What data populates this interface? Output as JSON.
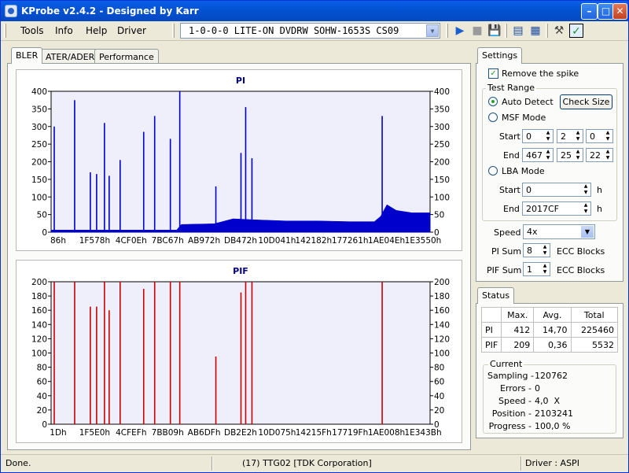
{
  "window": {
    "title": "KProbe v2.4.2 - Designed by Karr"
  },
  "menu": [
    "Tools",
    "Info",
    "Help",
    "Driver"
  ],
  "device": "1-0-0-0 LITE-ON DVDRW SOHW-1653S CS09",
  "tabs": [
    "BLER",
    "ATER/ADER",
    "Performance"
  ],
  "settings": {
    "tab": "Settings",
    "remove_spike": "Remove the spike",
    "test_range": "Test Range",
    "auto_detect": "Auto Detect",
    "check_size": "Check Size",
    "msf_mode": "MSF Mode",
    "start_label": "Start",
    "end_label": "End",
    "msf_start": [
      "0",
      "2",
      "0"
    ],
    "msf_end": [
      "467",
      "25",
      "22"
    ],
    "lba_mode": "LBA Mode",
    "lba_start": "0",
    "lba_end": "2017CF",
    "h": "h",
    "speed_label": "Speed",
    "speed_value": "4x",
    "pi_sum_label": "PI Sum",
    "pi_sum_value": "8",
    "pif_sum_label": "PIF Sum",
    "pif_sum_value": "1",
    "ecc_blocks": "ECC Blocks"
  },
  "status": {
    "tab": "Status",
    "headers": [
      "Max.",
      "Avg.",
      "Total"
    ],
    "rows": [
      {
        "label": "PI",
        "max": "412",
        "avg": "14,70",
        "total": "225460"
      },
      {
        "label": "PIF",
        "max": "209",
        "avg": "0,36",
        "total": "5532"
      }
    ],
    "current": "Current",
    "fields": [
      {
        "label": "Sampling -",
        "value": "120762"
      },
      {
        "label": "Errors -",
        "value": "0"
      },
      {
        "label": "Speed -",
        "value": "4,0  X"
      },
      {
        "label": "Position -",
        "value": "2103241"
      },
      {
        "label": "Progress -",
        "value": "100,0 %"
      }
    ]
  },
  "statusbar": {
    "left": "Done.",
    "middle": "(17) TTG02 [TDK Corporation]",
    "right": "Driver : ASPI"
  },
  "colors": {
    "pi_bar": "#0000cc",
    "pif_bar": "#cc0000",
    "plot_bg": "#efeffb",
    "title": "#000080"
  },
  "chart_data": [
    {
      "type": "bar",
      "title": "PI",
      "ylim": [
        0,
        400
      ],
      "yticks": [
        0,
        50,
        100,
        150,
        200,
        250,
        300,
        350,
        400
      ],
      "xticks": [
        "86h",
        "1F578h",
        "4CF0Eh",
        "7BC67h",
        "AB972h",
        "DB472h",
        "10D041h",
        "142182h",
        "177261h",
        "1AE04Eh",
        "1E3550h"
      ],
      "xrange": [
        0,
        120762
      ],
      "spikes": [
        [
          1000,
          300
        ],
        [
          7500,
          375
        ],
        [
          12500,
          170
        ],
        [
          14500,
          165
        ],
        [
          17000,
          310
        ],
        [
          18500,
          160
        ],
        [
          22000,
          205
        ],
        [
          29500,
          285
        ],
        [
          33000,
          330
        ],
        [
          38000,
          265
        ],
        [
          41000,
          410
        ],
        [
          52500,
          130
        ],
        [
          60500,
          225
        ],
        [
          62000,
          355
        ],
        [
          64000,
          210
        ],
        [
          105500,
          330
        ]
      ],
      "baseline": [
        [
          0,
          6
        ],
        [
          40000,
          6
        ],
        [
          41500,
          22
        ],
        [
          52000,
          24
        ],
        [
          58000,
          38
        ],
        [
          65000,
          35
        ],
        [
          75000,
          32
        ],
        [
          85000,
          32
        ],
        [
          95000,
          30
        ],
        [
          103000,
          30
        ],
        [
          105000,
          45
        ],
        [
          107000,
          78
        ],
        [
          110000,
          62
        ],
        [
          115000,
          55
        ],
        [
          120762,
          55
        ]
      ]
    },
    {
      "type": "bar",
      "title": "PIF",
      "ylim": [
        0,
        200
      ],
      "yticks": [
        0,
        20,
        40,
        60,
        80,
        100,
        120,
        140,
        160,
        180,
        200
      ],
      "xticks": [
        "1Dh",
        "1F5E0h",
        "4CFEFh",
        "7BB09h",
        "AB6DFh",
        "DB2E2h",
        "10D075h",
        "14215Fh",
        "17719Fh",
        "1AE008h",
        "1E343Bh"
      ],
      "xrange": [
        0,
        120762
      ],
      "spikes": [
        [
          1000,
          205
        ],
        [
          7500,
          209
        ],
        [
          12500,
          165
        ],
        [
          14500,
          165
        ],
        [
          17000,
          205
        ],
        [
          18500,
          160
        ],
        [
          22000,
          205
        ],
        [
          29500,
          190
        ],
        [
          33000,
          205
        ],
        [
          38000,
          205
        ],
        [
          41000,
          209
        ],
        [
          52500,
          95
        ],
        [
          60500,
          185
        ],
        [
          62000,
          205
        ],
        [
          64000,
          209
        ],
        [
          105500,
          209
        ]
      ]
    }
  ]
}
